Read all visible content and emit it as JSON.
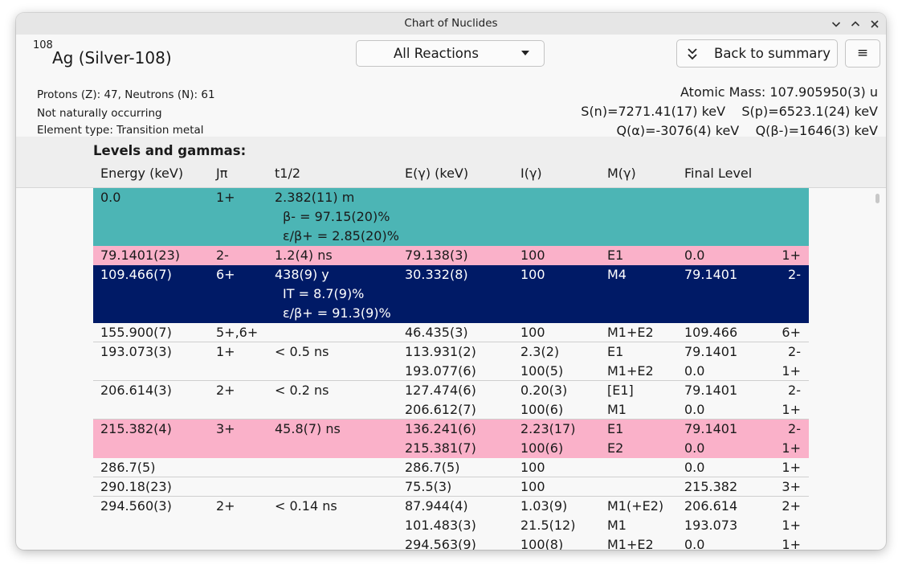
{
  "window": {
    "title": "Chart of Nuclides"
  },
  "nuclide": {
    "mass_number": "108",
    "name": "Ag (Silver-108)",
    "protons_neutrons": "Protons (Z):  47, Neutrons (N):  61",
    "occurrence": "Not naturally occurring",
    "element_type": "Element type: Transition metal"
  },
  "reactions_dropdown": {
    "selected": "All Reactions"
  },
  "toolbar": {
    "back_label": "Back to summary",
    "menu_glyph": "≡"
  },
  "properties": {
    "atomic_mass": "Atomic Mass: 107.905950(3) u",
    "separation": "S(n)=7271.41(17) keV    S(p)=6523.1(24) keV",
    "q_values": "Q(α)=-3076(4) keV    Q(β-)=1646(3) keV"
  },
  "levels": {
    "title": "Levels and gammas:",
    "headers": [
      "Energy (keV)",
      "Jπ",
      "t1/2",
      "E(γ) (keV)",
      "I(γ)",
      "M(γ)",
      "Final Level"
    ],
    "rows": [
      {
        "style": "cyan",
        "energy": "0.0",
        "jpi": "1+",
        "half_life": "2.382(11) m",
        "decays": [
          "β- = 97.15(20)%",
          "ε/β+ = 2.85(20)%"
        ],
        "gammas": []
      },
      {
        "style": "pink",
        "energy": "79.1401(23)",
        "jpi": "2-",
        "half_life": "1.2(4) ns",
        "decays": [],
        "gammas": [
          {
            "e": "79.138(3)",
            "i": "100",
            "m": "E1",
            "final": "0.0",
            "final_jpi": "1+"
          }
        ]
      },
      {
        "style": "navy",
        "energy": "109.466(7)",
        "jpi": "6+",
        "half_life": "438(9) y",
        "decays": [
          "IT = 8.7(9)%",
          "ε/β+ = 91.3(9)%"
        ],
        "gammas": [
          {
            "e": "30.332(8)",
            "i": "100",
            "m": "M4",
            "final": "79.1401",
            "final_jpi": "2-"
          }
        ]
      },
      {
        "style": "plain",
        "energy": "155.900(7)",
        "jpi": "5+,6+",
        "half_life": "",
        "decays": [],
        "gammas": [
          {
            "e": "46.435(3)",
            "i": "100",
            "m": "M1+E2",
            "final": "109.466",
            "final_jpi": "6+"
          }
        ]
      },
      {
        "style": "plain",
        "energy": "193.073(3)",
        "jpi": "1+",
        "half_life": "< 0.5 ns",
        "decays": [],
        "gammas": [
          {
            "e": "113.931(2)",
            "i": "2.3(2)",
            "m": "E1",
            "final": "79.1401",
            "final_jpi": "2-"
          },
          {
            "e": "193.077(6)",
            "i": "100(5)",
            "m": "M1+E2",
            "final": "0.0",
            "final_jpi": "1+"
          }
        ]
      },
      {
        "style": "plain",
        "energy": "206.614(3)",
        "jpi": "2+",
        "half_life": "< 0.2 ns",
        "decays": [],
        "gammas": [
          {
            "e": "127.474(6)",
            "i": "0.20(3)",
            "m": "[E1]",
            "final": "79.1401",
            "final_jpi": "2-"
          },
          {
            "e": "206.612(7)",
            "i": "100(6)",
            "m": "M1",
            "final": "0.0",
            "final_jpi": "1+"
          }
        ]
      },
      {
        "style": "pink",
        "energy": "215.382(4)",
        "jpi": "3+",
        "half_life": "45.8(7) ns",
        "decays": [],
        "gammas": [
          {
            "e": "136.241(6)",
            "i": "2.23(17)",
            "m": "E1",
            "final": "79.1401",
            "final_jpi": "2-"
          },
          {
            "e": "215.381(7)",
            "i": "100(6)",
            "m": "E2",
            "final": "0.0",
            "final_jpi": "1+"
          }
        ]
      },
      {
        "style": "plain",
        "energy": "286.7(5)",
        "jpi": "",
        "half_life": "",
        "decays": [],
        "gammas": [
          {
            "e": "286.7(5)",
            "i": "100",
            "m": "",
            "final": "0.0",
            "final_jpi": "1+"
          }
        ]
      },
      {
        "style": "plain",
        "energy": "290.18(23)",
        "jpi": "",
        "half_life": "",
        "decays": [],
        "gammas": [
          {
            "e": "75.5(3)",
            "i": "100",
            "m": "",
            "final": "215.382",
            "final_jpi": "3+"
          }
        ]
      },
      {
        "style": "plain",
        "energy": "294.560(3)",
        "jpi": "2+",
        "half_life": "< 0.14 ns",
        "decays": [],
        "gammas": [
          {
            "e": "87.944(4)",
            "i": "1.03(9)",
            "m": "M1(+E2)",
            "final": "206.614",
            "final_jpi": "2+"
          },
          {
            "e": "101.483(3)",
            "i": "21.5(12)",
            "m": "M1",
            "final": "193.073",
            "final_jpi": "1+"
          },
          {
            "e": "294.563(9)",
            "i": "100(8)",
            "m": "M1+E2",
            "final": "0.0",
            "final_jpi": "1+"
          }
        ]
      }
    ]
  }
}
